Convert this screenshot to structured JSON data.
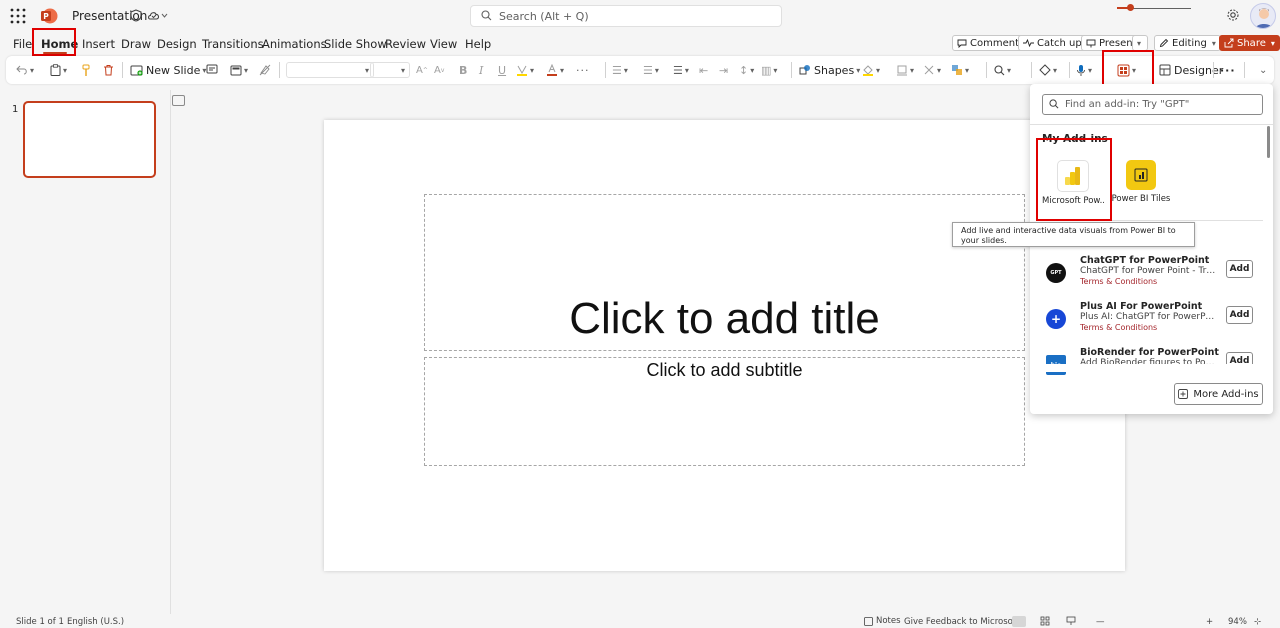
{
  "app": {
    "title": "Presentation",
    "search_placeholder": "Search (Alt + Q)",
    "accent": "#c43e1c"
  },
  "menu": {
    "tabs": [
      "File",
      "Home",
      "Insert",
      "Draw",
      "Design",
      "Transitions",
      "Animations",
      "Slide Show",
      "Review",
      "View",
      "Help"
    ],
    "active": "Home"
  },
  "actions": {
    "comments": "Comments",
    "catch_up": "Catch up",
    "present": "Present",
    "editing": "Editing",
    "share": "Share"
  },
  "ribbon": {
    "new_slide": "New Slide",
    "shapes": "Shapes",
    "designer": "Designer"
  },
  "thumbnails": {
    "slide_number": "1"
  },
  "slide": {
    "title_placeholder": "Click to add title",
    "subtitle_placeholder": "Click to add subtitle"
  },
  "addins": {
    "search_placeholder": "Find an add-in: Try \"GPT\"",
    "my_addins_label": "My Add-ins",
    "my_addins": [
      {
        "label": "Microsoft Pow...",
        "icon": "power-bi-icon"
      },
      {
        "label": "Power BI Tiles",
        "icon": "power-bi-tiles-icon"
      }
    ],
    "tooltip": "Add live and interactive data visuals from Power BI to your slides.",
    "recommended": [
      {
        "name": "ChatGPT for PowerPoint",
        "desc": "ChatGPT for Power Point - Transfor...",
        "terms": "Terms & Conditions",
        "add": "Add",
        "logo_text": "GPT",
        "logo_color": "#111111"
      },
      {
        "name": "Plus AI For PowerPoint",
        "desc": "Plus AI: ChatGPT for PowerPoint. Cr...",
        "terms": "Terms & Conditions",
        "add": "Add",
        "logo_text": "+",
        "logo_color": "#1747d6"
      },
      {
        "name": "BioRender for PowerPoint",
        "desc": "Add BioRender figures to PowerPoin...",
        "terms": "",
        "add": "Add",
        "logo_text": "bio",
        "logo_color": "#1a6fc4"
      }
    ],
    "more_addins": "More Add-ins"
  },
  "statusbar": {
    "slide_info": "Slide 1 of 1",
    "language": "English (U.S.)",
    "notes": "Notes",
    "feedback": "Give Feedback to Microsoft",
    "zoom": "94%",
    "zoom_level_percent": 18
  }
}
